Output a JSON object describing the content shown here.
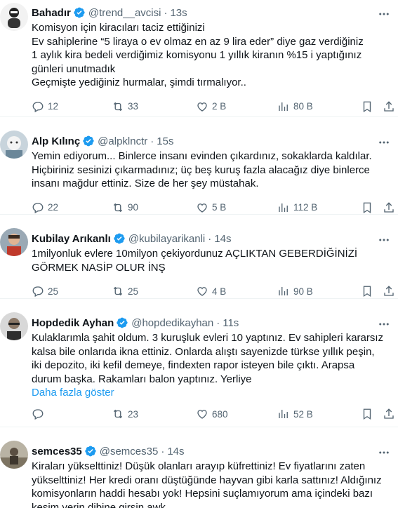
{
  "tweets": [
    {
      "name": "Bahadır",
      "handle": "@trend__avcisi",
      "time": "13s",
      "text": "Komisyon için kiracıları taciz ettiğinizi\nEv sahiplerine “5 liraya o ev olmaz en az 9 lira eder” diye gaz verdiğiniz\n1 aylık kira bedeli verdiğimiz komisyonu 1 yıllık kiranın %15 i yaptığınız\ngünleri unutmadık\nGeçmişte yediğiniz hurmalar, şimdi tırmalıyor..",
      "replies": "12",
      "retweets": "33",
      "likes": "2 B",
      "views": "80 B"
    },
    {
      "name": "Alp Kılınç",
      "handle": "@alpklnctr",
      "time": "15s",
      "text": "Yemin ediyorum... Binlerce insanı evinden çıkardınız, sokaklarda kaldılar.\nHiçbiriniz sesinizi çıkarmadınız; üç beş kuruş fazla alacağız diye binlerce\ninsanı mağdur ettiniz. Size de her şey müstahak.",
      "replies": "22",
      "retweets": "90",
      "likes": "5 B",
      "views": "112 B"
    },
    {
      "name": "Kubilay Arıkanlı",
      "handle": "@kubilayarikanli",
      "time": "14s",
      "text": "1milyonluk evlere 10milyon çekiyordunuz AÇLIKTAN GEBERDİĞİNİZİ\nGÖRMEK NASİP OLUR İNŞ",
      "replies": "25",
      "retweets": "25",
      "likes": "4 B",
      "views": "90 B"
    },
    {
      "name": "Hopdedik Ayhan",
      "handle": "@hopdedikayhan",
      "time": "11s",
      "text": "Kulaklarımla şahit oldum. 3 kuruşluk evleri 10 yaptınız. Ev sahipleri kararsız\nkalsa bile onlarıda ikna ettiniz. Onlarda alıştı sayenizde türkse yıllık peşin,\niki depozito, iki kefil demeye, findexten rapor isteyen bile çıktı. Arapsa\ndurum başka. Rakamları balon yaptınız. Yerliye",
      "show_more": "Daha fazla göster",
      "replies": "",
      "retweets": "23",
      "likes": "680",
      "views": "52 B"
    },
    {
      "name": "semces35",
      "handle": "@semces35",
      "time": "14s",
      "text": "Kiraları yükselttiniz! Düşük olanları arayıp küfrettiniz! Ev fiyatlarını zaten\nyükselttiniz! Her kredi oranı düştüğünde hayvan gibi karla sattınız! Aldığınız\nkomisyonların haddi hesabı yok! Hepsini suçlamıyorum ama içindeki bazı\nkesim yerin dibine girsin awk"
    }
  ],
  "separator": "·",
  "colors": {
    "verified": "#1d9bf0",
    "muted": "#536471",
    "link": "#1d9bf0",
    "text": "#0f1419"
  }
}
